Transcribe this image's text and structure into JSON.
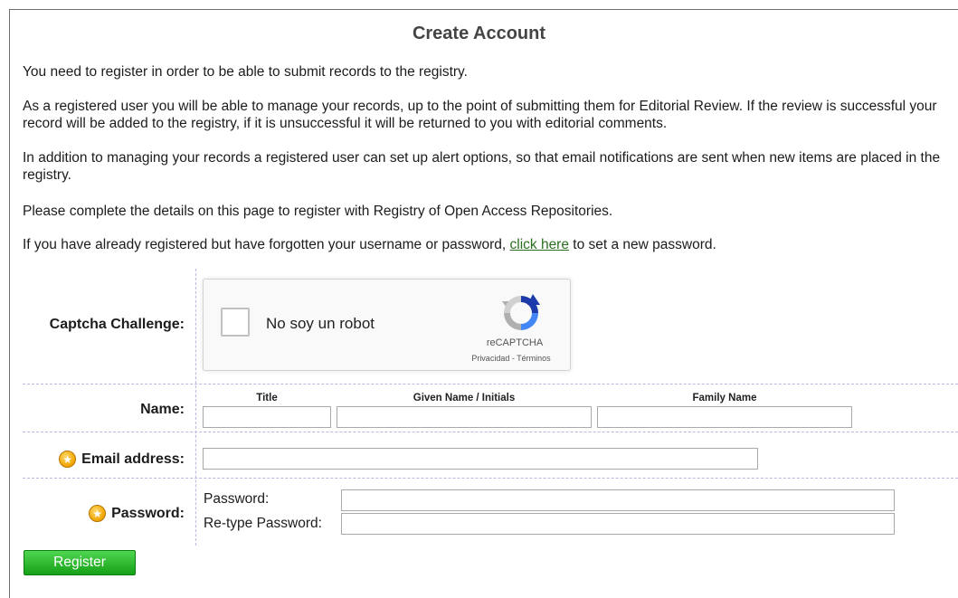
{
  "page": {
    "title": "Create Account"
  },
  "intro": {
    "p1": "You need to register in order to be able to submit records to the registry.",
    "p2": "As a registered user you will be able to manage your records, up to the point of submitting them for Editorial Review. If the review is successful your record will be added to the registry, if it is unsuccessful it will be returned to you with editorial comments.",
    "p3": "In addition to managing your records a registered user can set up alert options, so that email notifications are sent when new items are placed in the registry.",
    "p4": "Please complete the details on this page to register with Registry of Open Access Repositories.",
    "p5_before": "If you have already registered but have forgotten your username or password, ",
    "p5_link": "click here",
    "p5_after": " to set a new password."
  },
  "captcha": {
    "label": "Captcha Challenge:",
    "checkbox_text": "No soy un robot",
    "brand": "reCAPTCHA",
    "links": "Privacidad - Términos"
  },
  "name": {
    "label": "Name:",
    "col_title": "Title",
    "col_given": "Given Name / Initials",
    "col_family": "Family Name",
    "title_value": "",
    "given_value": "",
    "family_value": ""
  },
  "email": {
    "label": "Email address:",
    "value": ""
  },
  "password": {
    "label": "Password:",
    "field1_label": "Password:",
    "field2_label": "Re-type Password:",
    "value1": "",
    "value2": ""
  },
  "register_label": "Register",
  "colors": {
    "link": "#2a6f1f",
    "button_green": "#15a016",
    "required_star": "#f0a500",
    "divider": "#b8b8e0"
  },
  "icons": {
    "required": "star-icon",
    "captcha": "recaptcha-logo-icon"
  }
}
